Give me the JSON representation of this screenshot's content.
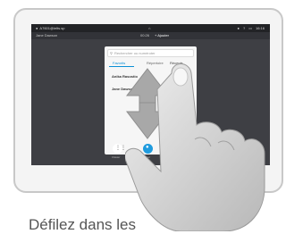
{
  "statusbar": {
    "address": "A7601@ielts.sp",
    "time": "16:16"
  },
  "callbar": {
    "caller": "Jane Dawson",
    "duration": "00:26",
    "add_label": "Ajouter"
  },
  "panel": {
    "search_placeholder": "Rechercher ou numéroter",
    "tabs": [
      "Favorits",
      "Répertoire",
      "Récents"
    ],
    "items": [
      "Anika Rasostio",
      "Jane Dawson"
    ]
  },
  "toolbar": {
    "buttons": [
      {
        "label": "Clavier",
        "color": "#ffffff"
      },
      {
        "label": "Appel",
        "color": "#1f9bde"
      }
    ]
  },
  "caption": "Défilez dans les",
  "colors": {
    "accent": "#1f9bde",
    "screen_bg": "#3e3f44",
    "arrow_fill": "#a8a8a8"
  }
}
